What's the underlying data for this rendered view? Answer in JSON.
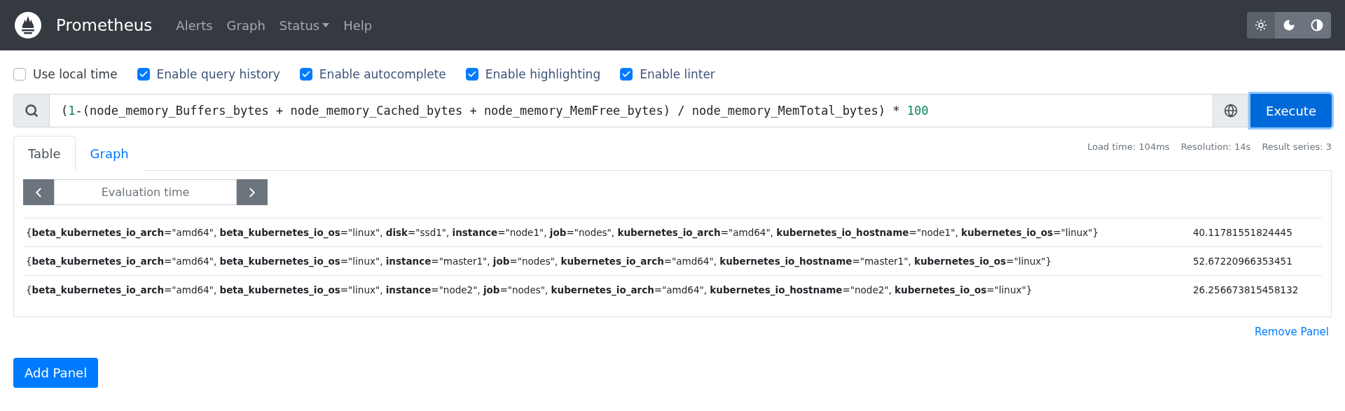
{
  "navbar": {
    "brand": "Prometheus",
    "links": [
      {
        "label": "Alerts",
        "dropdown": false
      },
      {
        "label": "Graph",
        "dropdown": false
      },
      {
        "label": "Status",
        "dropdown": true
      },
      {
        "label": "Help",
        "dropdown": false
      }
    ],
    "theme_buttons": [
      {
        "kind": "light",
        "selected": true
      },
      {
        "kind": "dark",
        "selected": false
      },
      {
        "kind": "auto",
        "selected": false
      }
    ]
  },
  "options": [
    {
      "label": "Use local time",
      "checked": false
    },
    {
      "label": "Enable query history",
      "checked": true
    },
    {
      "label": "Enable autocomplete",
      "checked": true
    },
    {
      "label": "Enable highlighting",
      "checked": true
    },
    {
      "label": "Enable linter",
      "checked": true
    }
  ],
  "query": {
    "tokens": [
      {
        "text": "(",
        "kind": "plain"
      },
      {
        "text": "1",
        "kind": "number"
      },
      {
        "text": "-(node_memory_Buffers_bytes + node_memory_Cached_bytes + node_memory_MemFree_bytes) / node_memory_MemTotal_bytes) * ",
        "kind": "plain"
      },
      {
        "text": "100",
        "kind": "number"
      }
    ],
    "execute": "Execute"
  },
  "panel": {
    "tabs": [
      {
        "label": "Table",
        "selected": true
      },
      {
        "label": "Graph",
        "selected": false
      }
    ],
    "stats": [
      "Load time: 104ms",
      "Resolution: 14s",
      "Result series: 3"
    ],
    "evaluation_time": {
      "placeholder": "Evaluation time"
    },
    "rows": [
      {
        "labels": "{**beta_kubernetes_io_arch**=\"amd64\", **beta_kubernetes_io_os**=\"linux\", **disk**=\"ssd1\", **instance**=\"node1\", **job**=\"nodes\", **kubernetes_io_arch**=\"amd64\", **kubernetes_io_hostname**=\"node1\", **kubernetes_io_os**=\"linux\"}",
        "value": "40.11781551824445"
      },
      {
        "labels": "{**beta_kubernetes_io_arch**=\"amd64\", **beta_kubernetes_io_os**=\"linux\", **instance**=\"master1\", **job**=\"nodes\", **kubernetes_io_arch**=\"amd64\", **kubernetes_io_hostname**=\"master1\", **kubernetes_io_os**=\"linux\"}",
        "value": "52.67220966353451"
      },
      {
        "labels": "{**beta_kubernetes_io_arch**=\"amd64\", **beta_kubernetes_io_os**=\"linux\", **instance**=\"node2\", **job**=\"nodes\", **kubernetes_io_arch**=\"amd64\", **kubernetes_io_hostname**=\"node2\", **kubernetes_io_os**=\"linux\"}",
        "value": "26.256673815458132"
      }
    ],
    "remove": "Remove Panel"
  },
  "add_panel": "Add Panel"
}
